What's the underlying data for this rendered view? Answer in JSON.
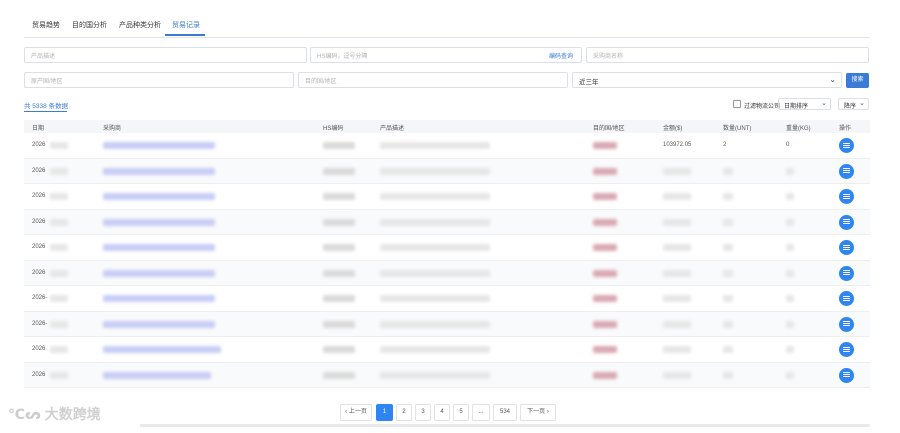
{
  "tabs": [
    {
      "label": "贸易趋势"
    },
    {
      "label": "目的国分析"
    },
    {
      "label": "产品种类分析"
    },
    {
      "label": "贸易记录"
    }
  ],
  "active_tab": 3,
  "search": {
    "product_placeholder": "产品描述",
    "hs_placeholder": "HS编码，逗号分隔",
    "hs_link": "编码查询",
    "buyer_placeholder": "采购商名称",
    "origin_placeholder": "原产国/地区",
    "dest_placeholder": "目的国/地区",
    "period_value": "近三年",
    "search_button": "搜索"
  },
  "result": {
    "count_label": "共 5338 条数据",
    "filter_label": "过滤物流公司",
    "sort_field": "日期排序",
    "sort_order": "降序"
  },
  "table": {
    "headers": [
      "日期",
      "采购商",
      "HS编码",
      "产品描述",
      "目的国/地区",
      "金额($)",
      "数量(UNT)",
      "重量(KG)",
      "操作"
    ],
    "rows": [
      {
        "date": "2026",
        "amount": "103972.05",
        "qty": "2",
        "weight": "0"
      },
      {
        "date": "2026",
        "amount": "",
        "qty": "",
        "weight": ""
      },
      {
        "date": "2026",
        "amount": "",
        "qty": "",
        "weight": ""
      },
      {
        "date": "2026",
        "amount": "",
        "qty": "",
        "weight": ""
      },
      {
        "date": "2026",
        "amount": "",
        "qty": "",
        "weight": ""
      },
      {
        "date": "2026",
        "amount": "",
        "qty": "",
        "weight": ""
      },
      {
        "date": "2026-",
        "amount": "",
        "qty": "",
        "weight": ""
      },
      {
        "date": "2026-",
        "amount": "",
        "qty": "",
        "weight": ""
      },
      {
        "date": "2026",
        "amount": "",
        "qty": "",
        "weight": ""
      },
      {
        "date": "2026",
        "amount": "",
        "qty": "",
        "weight": ""
      }
    ]
  },
  "pagination": {
    "prev": "‹ 上一页",
    "pages": [
      "1",
      "2",
      "3",
      "4",
      "5",
      "...",
      "534"
    ],
    "next": "下一页 ›",
    "current": "1"
  },
  "watermark": "大数跨境",
  "colors": {
    "accent": "#3a7bd5",
    "op_button": "#2f86f0"
  },
  "icons": {
    "operation": "list-icon",
    "dropdown": "chevron-down-icon"
  }
}
